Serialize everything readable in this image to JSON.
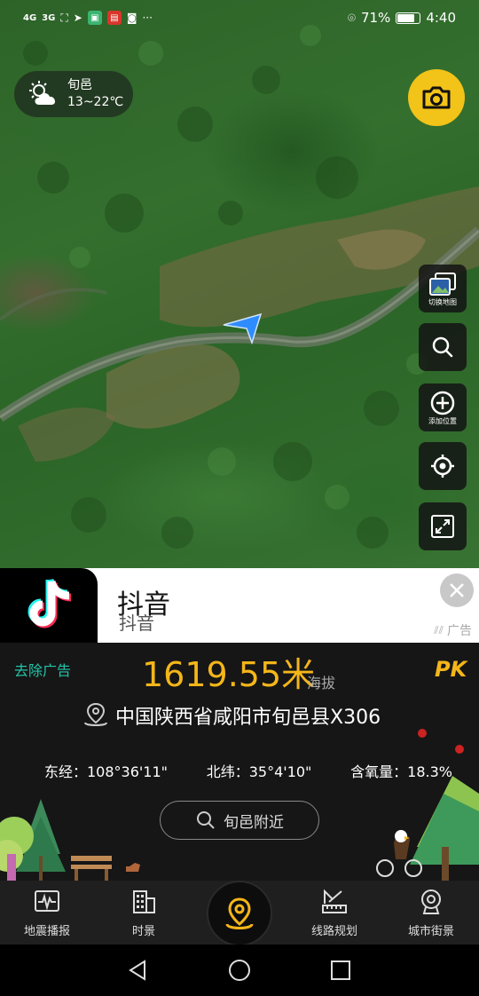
{
  "status_bar": {
    "signal_1": "4G",
    "signal_2": "3G",
    "battery_percent": "71%",
    "time": "4:40"
  },
  "weather": {
    "city": "旬邑",
    "temp_range": "13~22℃",
    "icon": "partly-cloudy-icon"
  },
  "map_tools": {
    "switch_map_label": "切换地图",
    "add_location_label": "添加位置"
  },
  "ad": {
    "title": "抖音",
    "subtitle": "抖音",
    "tag": "广告"
  },
  "info": {
    "remove_ad": "去除广告",
    "altitude": "1619.55米",
    "altitude_label": "海拔",
    "pk": "PK",
    "address": "中国陕西省咸阳市旬邑县X306",
    "longitude": "东经：108°36'11\"",
    "latitude": "北纬：35°4'10\"",
    "oxygen": "含氧量：18.3%",
    "nearby_button": "旬邑附近"
  },
  "bottom_nav": {
    "items": [
      {
        "label": "地震播报",
        "icon": "earthquake-icon"
      },
      {
        "label": "时景",
        "icon": "building-icon"
      },
      {
        "label": "",
        "icon": "location-pin-icon"
      },
      {
        "label": "线路规划",
        "icon": "route-ruler-icon"
      },
      {
        "label": "城市街景",
        "icon": "street-view-icon"
      }
    ]
  },
  "colors": {
    "accent_yellow": "#f4b619",
    "teal": "#23c4a8",
    "camera_yellow": "#f2c318",
    "location_blue": "#2f8cff"
  }
}
